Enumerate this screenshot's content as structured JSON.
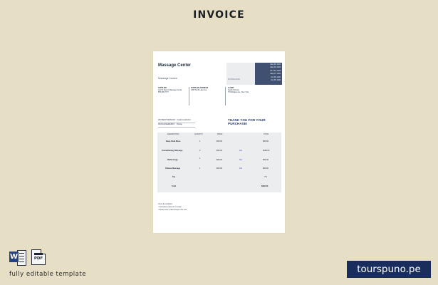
{
  "header": {
    "title": "INVOICE"
  },
  "invoice": {
    "company": "Massage Center",
    "subtitle": "Massage Invoice",
    "top_box_label": "INVOICE DATE",
    "dates": [
      "May 28, 2023",
      "May 30, 2023",
      "03 / 09 / 2023",
      "May 07, 2024",
      "Jun 05, 2024",
      "Jun 05, 2024"
    ],
    "addresses": [
      {
        "heading": "SUPPLIER",
        "lines": [
          "Gulf of Mexico Massage Center",
          "555-555-7777"
        ]
      },
      {
        "heading": "SUPPLIER ADDRESS",
        "lines": [
          "1999 North Lake Ave"
        ]
      },
      {
        "heading": "CLIENT",
        "lines": [
          "Sarah Johnson",
          "75 Michigan Ave, New York"
        ]
      }
    ],
    "meta": [
      {
        "label": "PAYMENT METHOD",
        "value": "Credit Card/ACH"
      },
      {
        "label": "OFFICE REMARKS",
        "value": "Pickup"
      }
    ],
    "thanks": "THANK YOU FOR YOUR PURCHASE!",
    "columns": [
      "DESCRIPTION",
      "QUANTITY",
      "PRICE",
      "",
      "TOTAL"
    ],
    "items": [
      {
        "description": "Deep Fluid Mass",
        "qty": "1",
        "price": "$50.00",
        "extra": "",
        "total": "$50.00"
      },
      {
        "description": "Aromatherapy Massage",
        "qty": "2",
        "price": "$50.00",
        "extra": "Del",
        "total": "$100.00"
      },
      {
        "description": "Reflexology",
        "qty": "1",
        "price": "$50.00",
        "extra": "Del",
        "total": "$50.00"
      },
      {
        "description": "Shiatsu Massage",
        "qty": "1",
        "price": "$50.00",
        "extra": "Del",
        "total": "$50.00"
      }
    ],
    "tax_label": "Tax",
    "tax_value": "7%",
    "total_label": "Total",
    "total_value": "$262.50",
    "terms": [
      "Terms & Conditions",
      "• Incomplete payment of a week",
      "• Please keep a valid receipt of the visit"
    ]
  },
  "footer": {
    "word_letter": "W",
    "pdf_label": "PDF",
    "editable_text": "fully editable template",
    "brand": "tourspuno.pe"
  },
  "colors": {
    "background": "#e6dfc6",
    "navy": "#3f5070",
    "brand": "#1a2e5e"
  },
  "icons": [
    "word-icon",
    "pdf-icon"
  ]
}
